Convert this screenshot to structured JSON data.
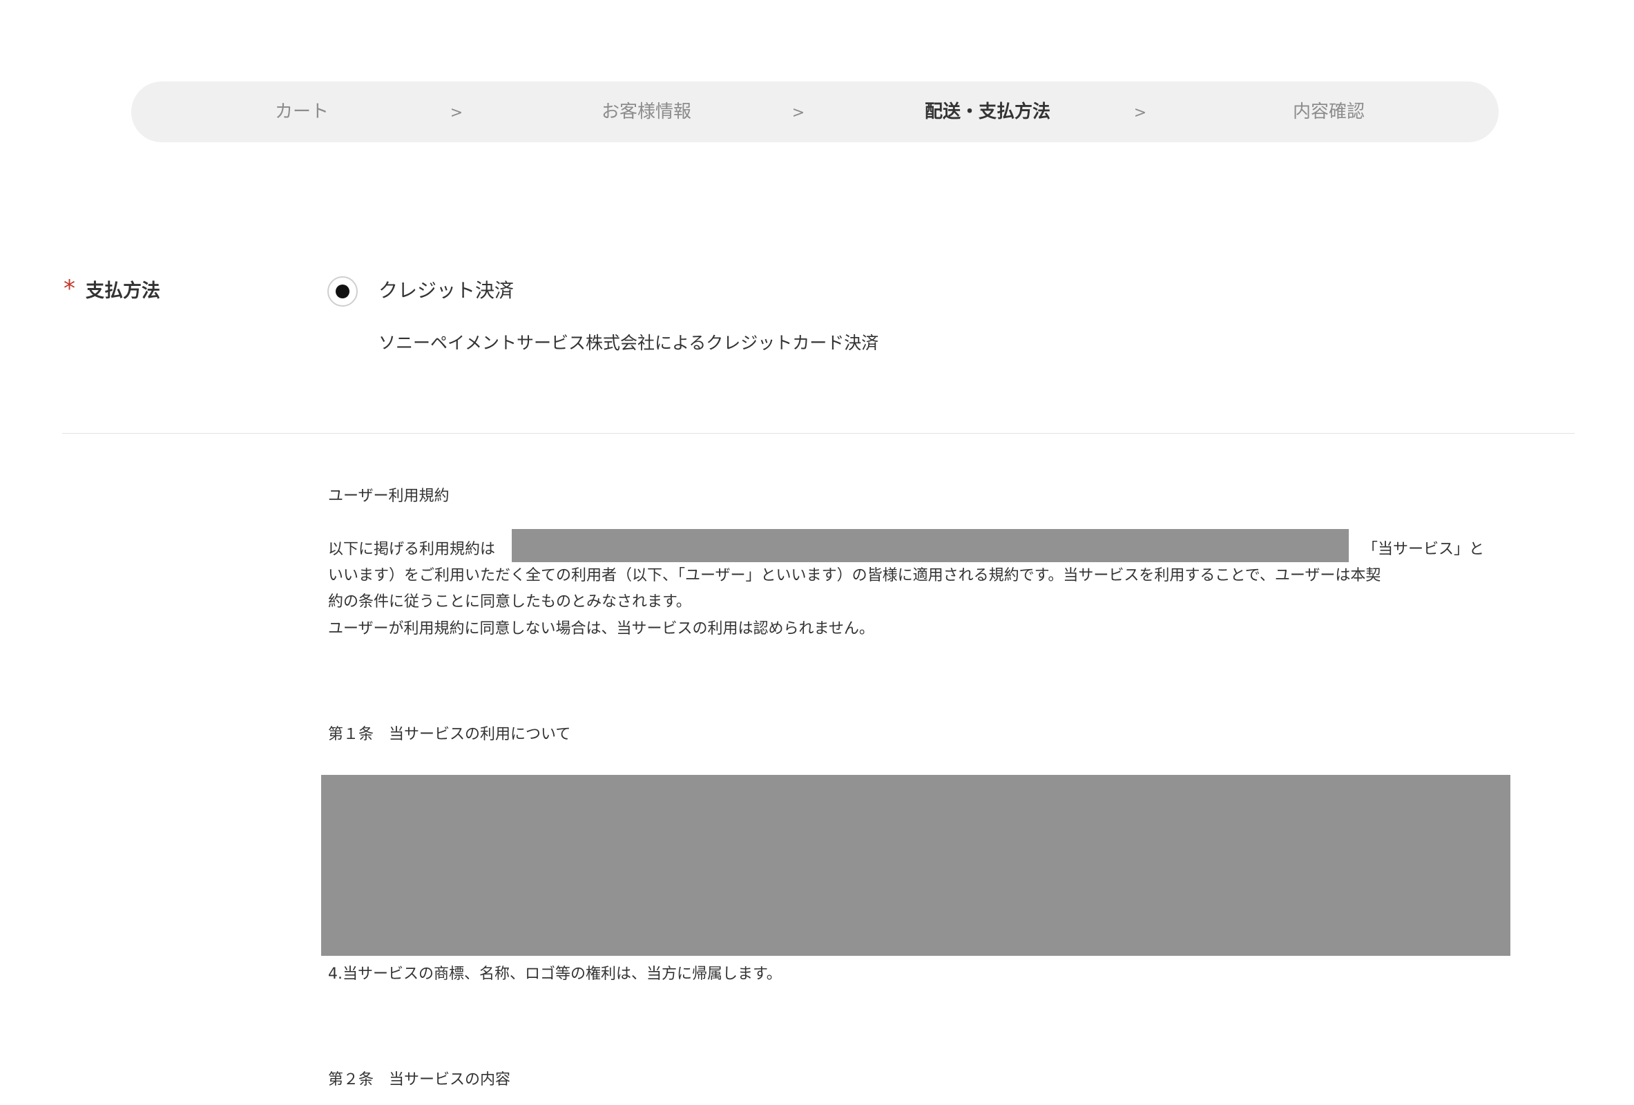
{
  "steps": {
    "items": [
      {
        "label": "カート"
      },
      {
        "label": "お客様情報"
      },
      {
        "label": "配送・支払方法"
      },
      {
        "label": "内容確認"
      }
    ],
    "separator": ">",
    "active_index": 2
  },
  "payment": {
    "required_mark": "*",
    "label": "支払方法",
    "option_label": "クレジット決済",
    "option_selected": true,
    "description": "ソニーペイメントサービス株式会社によるクレジットカード決済"
  },
  "terms": {
    "title": "ユーザー利用規約",
    "intro_line1_prefix": "以下に掲げる利用規約は",
    "intro_line1_suffix": "「当サービス」と",
    "intro_line2": "いいます）をご利用いただく全ての利用者（以下、「ユーザー」といいます）の皆様に適用される規約です。当サービスを利用することで、ユーザーは本契",
    "intro_line3": "約の条件に従うことに同意したものとみなされます。",
    "intro_line4": "ユーザーが利用規約に同意しない場合は、当サービスの利用は認められません。",
    "article1_title": "第１条　当サービスの利用について",
    "article1_item4": "4.当サービスの商標、名称、ロゴ等の権利は、当方に帰属します。",
    "article2_title": "第２条　当サービスの内容"
  },
  "colors": {
    "steps_bg": "#f0f0f0",
    "required": "#c0392b",
    "redaction": "#929292",
    "divider": "#e2e2e2"
  }
}
